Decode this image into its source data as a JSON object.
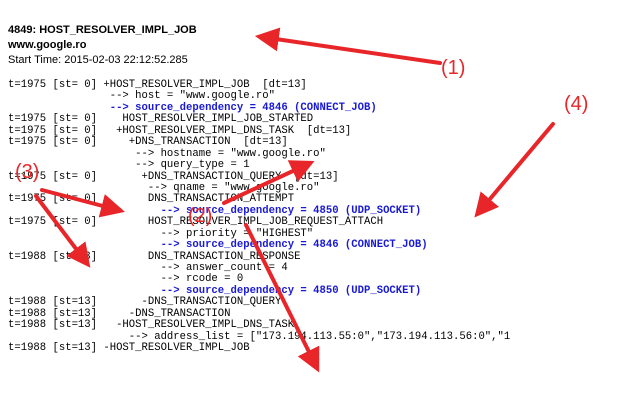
{
  "header": {
    "title": "4849: HOST_RESOLVER_IMPL_JOB",
    "host": "www.google.ro",
    "start_time": "Start Time: 2015-02-03 22:12:52.285"
  },
  "log_lines": [
    {
      "text": "t=1975 [st= 0] +HOST_RESOLVER_IMPL_JOB  [dt=13]",
      "link": false
    },
    {
      "text": "                --> host = \"www.google.ro\"",
      "link": false
    },
    {
      "text": "                --> source_dependency = 4846 (CONNECT_JOB)",
      "link": true
    },
    {
      "text": "t=1975 [st= 0]    HOST_RESOLVER_IMPL_JOB_STARTED",
      "link": false
    },
    {
      "text": "t=1975 [st= 0]   +HOST_RESOLVER_IMPL_DNS_TASK  [dt=13]",
      "link": false
    },
    {
      "text": "t=1975 [st= 0]     +DNS_TRANSACTION  [dt=13]",
      "link": false
    },
    {
      "text": "                    --> hostname = \"www.google.ro\"",
      "link": false
    },
    {
      "text": "                    --> query_type = 1",
      "link": false
    },
    {
      "text": "t=1975 [st= 0]       +DNS_TRANSACTION_QUERY  [dt=13]",
      "link": false
    },
    {
      "text": "                      --> qname = \"www.google.ro\"",
      "link": false
    },
    {
      "text": "t=1975 [st= 0]        DNS_TRANSACTION_ATTEMPT",
      "link": false
    },
    {
      "text": "                        --> source_dependency = 4850 (UDP_SOCKET)",
      "link": true
    },
    {
      "text": "t=1975 [st= 0]        HOST_RESOLVER_IMPL_JOB_REQUEST_ATTACH",
      "link": false
    },
    {
      "text": "                        --> priority = \"HIGHEST\"",
      "link": false
    },
    {
      "text": "                        --> source_dependency = 4846 (CONNECT_JOB)",
      "link": true
    },
    {
      "text": "t=1988 [st=13]        DNS_TRANSACTION_RESPONSE",
      "link": false
    },
    {
      "text": "                        --> answer_count = 4",
      "link": false
    },
    {
      "text": "                        --> rcode = 0",
      "link": false
    },
    {
      "text": "                        --> source_dependency = 4850 (UDP_SOCKET)",
      "link": true
    },
    {
      "text": "t=1988 [st=13]       -DNS_TRANSACTION_QUERY",
      "link": false
    },
    {
      "text": "t=1988 [st=13]     -DNS_TRANSACTION",
      "link": false
    },
    {
      "text": "t=1988 [st=13]   -HOST_RESOLVER_IMPL_DNS_TASK",
      "link": false
    },
    {
      "text": "                   --> address_list = [\"173.194.113.55:0\",\"173.194.113.56:0\",\"1",
      "link": false
    },
    {
      "text": "t=1988 [st=13] -HOST_RESOLVER_IMPL_JOB",
      "link": false
    }
  ],
  "annotations": {
    "label_1": "(1)",
    "label_2": "(2)",
    "label_3": "(3)",
    "label_4": "(4)",
    "color": "#e8262a"
  },
  "colors": {
    "link": "#1a1ad6"
  }
}
